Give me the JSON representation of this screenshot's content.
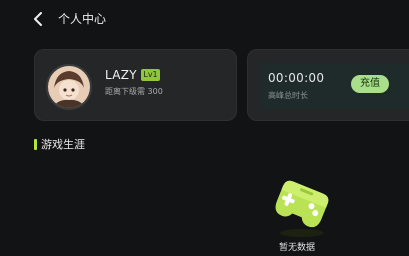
{
  "header": {
    "title": "个人中心",
    "back_icon": "chevron-left-icon"
  },
  "profile": {
    "username": "LAZY .",
    "level": "Lv1",
    "level_progress": "距离下级需 300",
    "avatar": "avatar-image"
  },
  "playtime": {
    "value": "00:00:00",
    "label": "高峰总时长",
    "recharge_label": "充值"
  },
  "section": {
    "title": "游戏生涯"
  },
  "empty_state": {
    "text": "暂无数据",
    "icon": "gamepad-icon"
  },
  "colors": {
    "background": "#121314",
    "card": "#252627",
    "accent_green": "#a9df8a",
    "level_badge": "#8fc63a",
    "section_bar": "#b7e43a"
  }
}
